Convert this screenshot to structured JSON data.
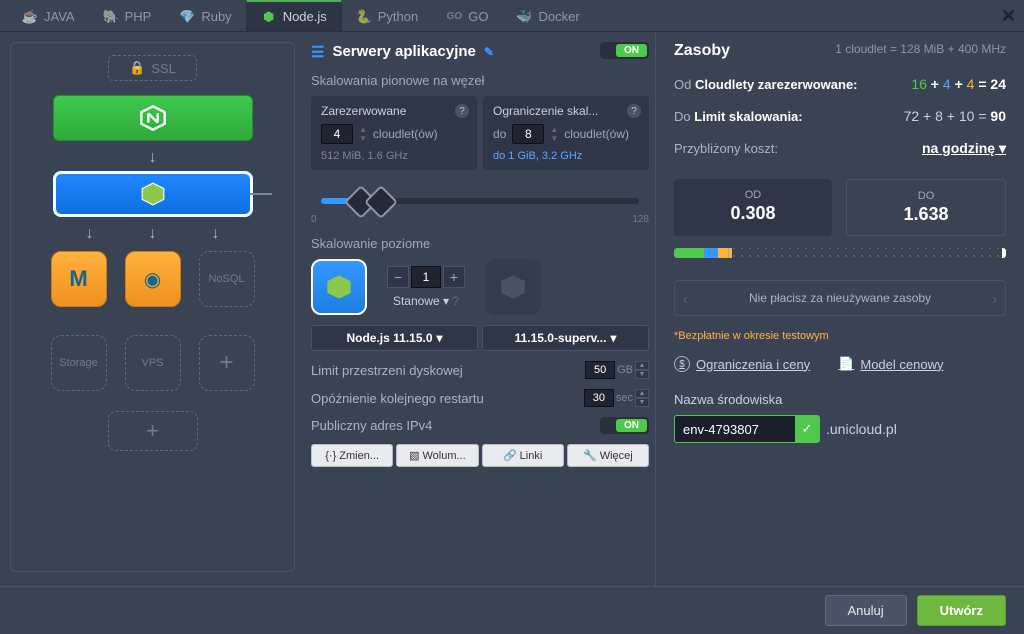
{
  "tabs": [
    {
      "label": "JAVA",
      "icon": "java"
    },
    {
      "label": "PHP",
      "icon": "php"
    },
    {
      "label": "Ruby",
      "icon": "ruby"
    },
    {
      "label": "Node.js",
      "icon": "nodejs",
      "active": true
    },
    {
      "label": "Python",
      "icon": "python"
    },
    {
      "label": "GO",
      "icon": "go"
    },
    {
      "label": "Docker",
      "icon": "docker"
    }
  ],
  "left": {
    "ssl": "SSL",
    "tiles": {
      "storage": "Storage",
      "vps": "VPS",
      "nosql": "NoSQL"
    }
  },
  "mid": {
    "title": "Serwery aplikacyjne",
    "toggle_on": "ON",
    "vertical_scaling_label": "Skalowania pionowe na węzeł",
    "reserved": {
      "label": "Zarezerwowane",
      "value": "4",
      "unit": "cloudlet(ów)",
      "spec": "512 MiB, 1.6 GHz"
    },
    "limit": {
      "label": "Ograniczenie skal...",
      "prefix": "do",
      "value": "8",
      "unit": "cloudlet(ów)",
      "spec": "do 1 GiB, 3.2 GHz"
    },
    "slider": {
      "min": "0",
      "max": "128"
    },
    "horizontal_scaling_label": "Skalowanie poziome",
    "instance_count": "1",
    "stateful": "Stanowe",
    "version_dropdown": "Node.js 11.15.0",
    "tag_dropdown": "11.15.0-superv...",
    "disk": {
      "label": "Limit przestrzeni dyskowej",
      "value": "50",
      "unit": "GB"
    },
    "restart": {
      "label": "Opóźnienie kolejnego restartu",
      "value": "30",
      "unit": "sec"
    },
    "ipv4": {
      "label": "Publiczny adres IPv4",
      "on": "ON"
    },
    "actions": {
      "change": "Zmien...",
      "volumes": "Wolum...",
      "links": "Linki",
      "more": "Więcej"
    }
  },
  "right": {
    "title": "Zasoby",
    "sub": "1 cloudlet = 128 MiB + 400 MHz",
    "reserved_label_prefix": "Od",
    "reserved_label": "Cloudlety zarezerwowane:",
    "reserved_formula": {
      "a": "16",
      "b": "4",
      "c": "4",
      "total": "24"
    },
    "limit_label_prefix": "Do",
    "limit_label": "Limit skalowania:",
    "limit_formula": {
      "a": "72",
      "b": "8",
      "c": "10",
      "total": "90"
    },
    "cost_label": "Przybliżony koszt:",
    "cost_period": "na godzinę",
    "price_from": {
      "label": "OD",
      "value": "0.308"
    },
    "price_to": {
      "label": "DO",
      "value": "1.638"
    },
    "info": "Nie płacisz za nieużywane zasoby",
    "asterisk": "*Bezpłatnie w okresie testowym",
    "link_pricing": "Ograniczenia i ceny",
    "link_model": "Model cenowy",
    "env_label": "Nazwa środowiska",
    "env_value": "env-4793807",
    "env_domain": ".unicloud.pl"
  },
  "footer": {
    "cancel": "Anuluj",
    "create": "Utwórz"
  }
}
